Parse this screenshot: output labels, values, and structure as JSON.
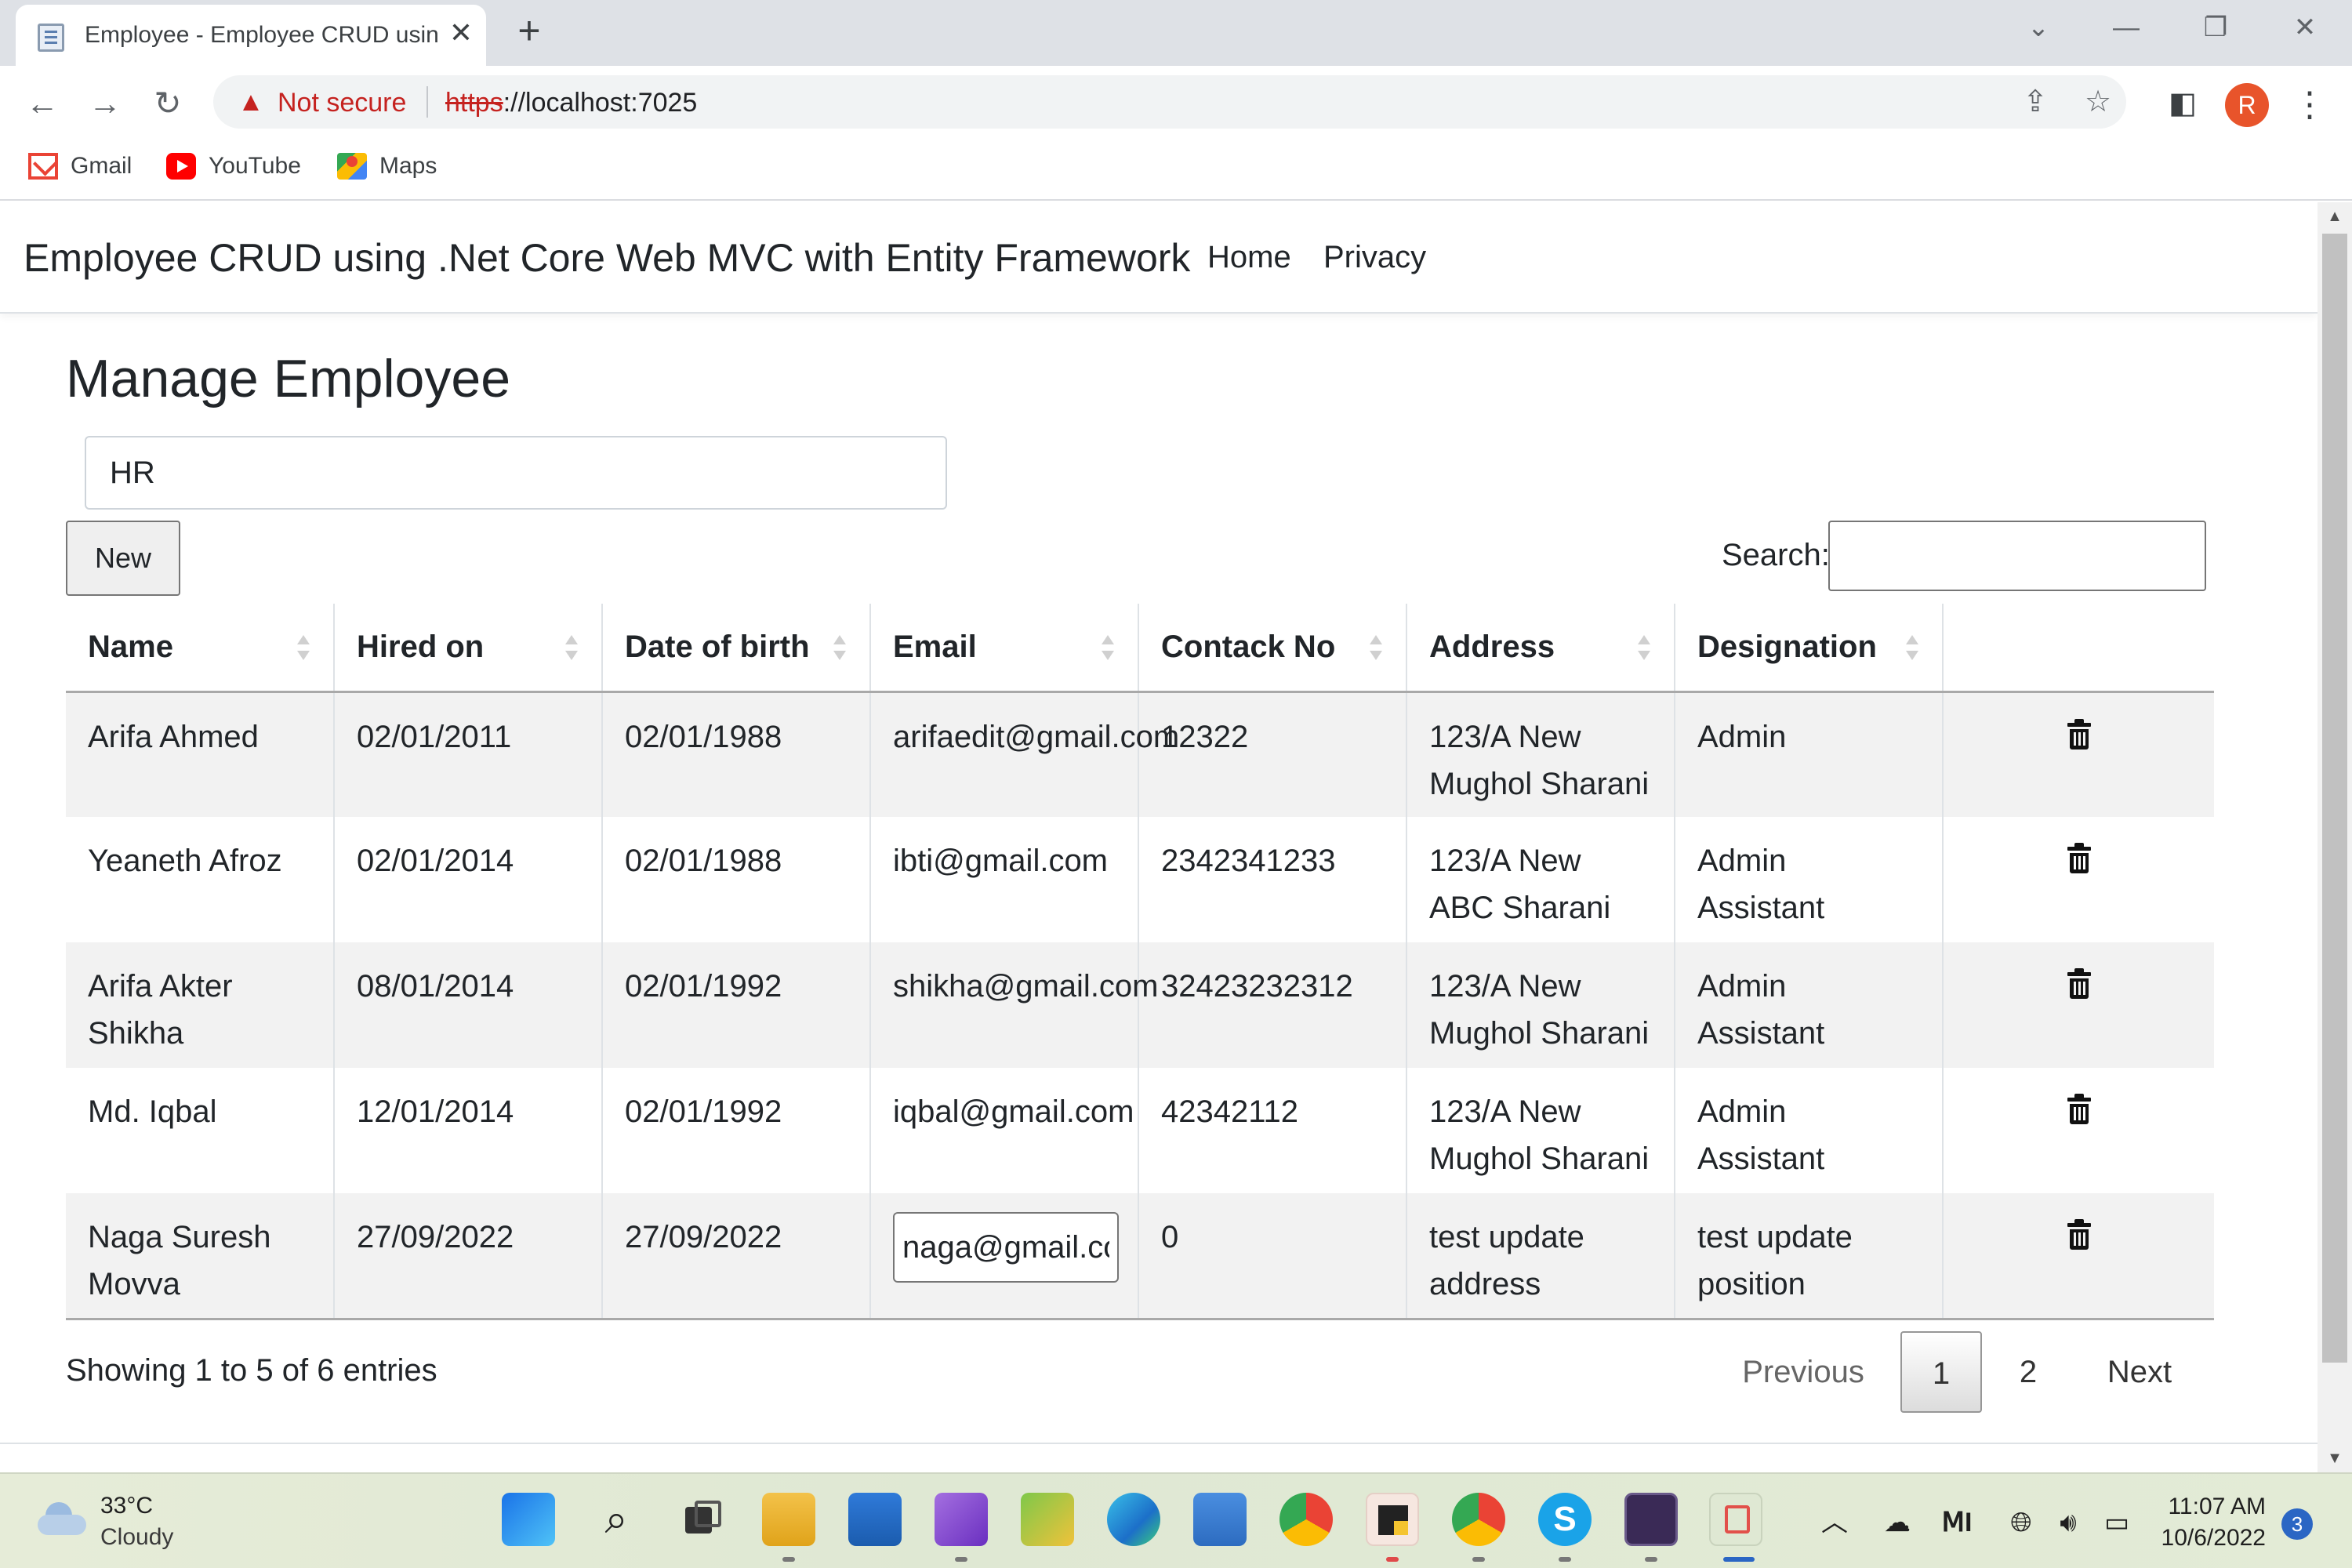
{
  "browser": {
    "tab_title": "Employee - Employee CRUD usin",
    "tab_close": "✕",
    "new_tab": "+",
    "window_controls": {
      "chevron": "⌄",
      "minimize": "—",
      "restore": "❐",
      "close": "✕"
    },
    "security_label": "Not secure",
    "url_scheme": "https",
    "url_rest": "://localhost:7025",
    "profile_initial": "R",
    "bookmarks": [
      {
        "label": "Gmail",
        "icon": "gmail-icon"
      },
      {
        "label": "YouTube",
        "icon": "youtube-icon"
      },
      {
        "label": "Maps",
        "icon": "maps-icon"
      }
    ]
  },
  "navbar": {
    "brand": "Employee CRUD using .Net Core Web MVC with Entity Framework",
    "links": [
      "Home",
      "Privacy"
    ]
  },
  "page": {
    "title": "Manage Employee",
    "department_value": "HR",
    "new_button": "New",
    "search_label": "Search:",
    "search_value": ""
  },
  "table": {
    "columns": [
      "Name",
      "Hired on",
      "Date of birth",
      "Email",
      "Contack No",
      "Address",
      "Designation",
      ""
    ],
    "rows": [
      {
        "name": "Arifa Ahmed",
        "hired": "02/01/2011",
        "dob": "02/01/1988",
        "email": "arifaedit@gmail.com",
        "contact": "12322",
        "address": "123/A New Mughol Sharani",
        "designation": "Admin"
      },
      {
        "name": "Yeaneth Afroz",
        "hired": "02/01/2014",
        "dob": "02/01/1988",
        "email": "ibti@gmail.com",
        "contact": "2342341233",
        "address": "123/A New ABC Sharani",
        "designation": "Admin Assistant"
      },
      {
        "name": "Arifa Akter Shikha",
        "hired": "08/01/2014",
        "dob": "02/01/1992",
        "email": "shikha@gmail.com",
        "contact": "32423232312",
        "address": "123/A New Mughol Sharani",
        "designation": "Admin Assistant"
      },
      {
        "name": "Md. Iqbal",
        "hired": "12/01/2014",
        "dob": "02/01/1992",
        "email": "iqbal@gmail.com",
        "contact": "42342112",
        "address": "123/A New Mughol Sharani",
        "designation": "Admin Assistant"
      },
      {
        "name": "Naga Suresh Movva",
        "hired": "27/09/2022",
        "dob": "27/09/2022",
        "email": "naga@gmail.com",
        "contact": "0",
        "address": "test update address",
        "designation": "test update position"
      }
    ]
  },
  "pagination": {
    "info": "Showing 1 to 5 of 6 entries",
    "previous": "Previous",
    "pages": [
      "1",
      "2"
    ],
    "current": "1",
    "next": "Next"
  },
  "taskbar": {
    "temperature": "33°C",
    "condition": "Cloudy",
    "time": "11:07 AM",
    "date": "10/6/2022",
    "notifications": "3"
  }
}
